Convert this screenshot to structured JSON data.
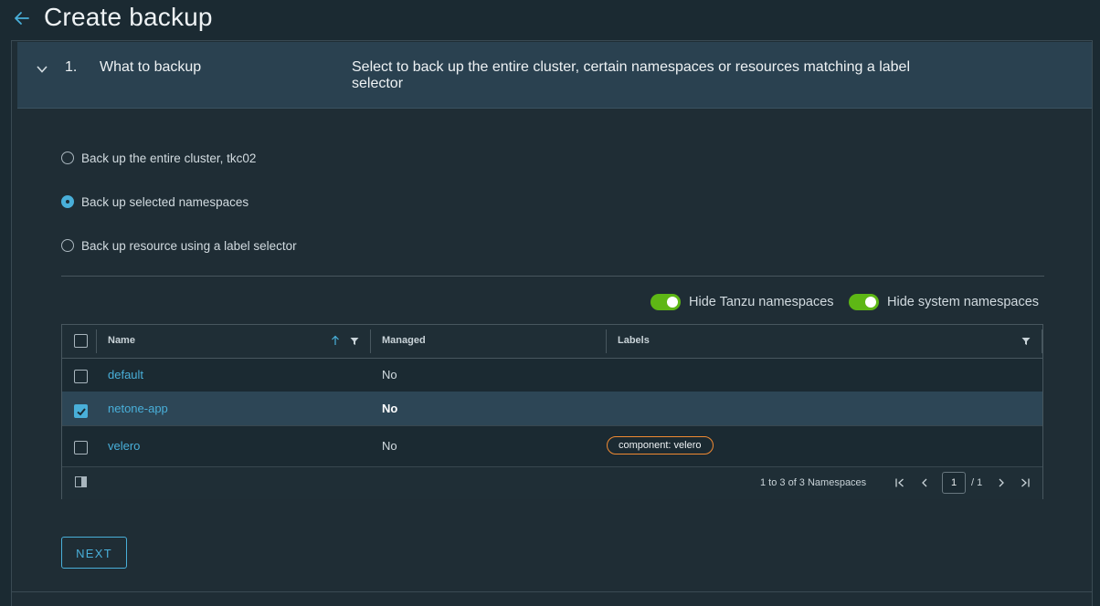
{
  "header": {
    "title": "Create backup",
    "back_icon": "arrow-left-icon"
  },
  "step": {
    "number": "1.",
    "title": "What to backup",
    "description": "Select to back up the entire cluster, certain namespaces or resources matching a label selector"
  },
  "scope_options": [
    {
      "label": "Back up the entire cluster, tkc02",
      "selected": false
    },
    {
      "label": "Back up selected namespaces",
      "selected": true
    },
    {
      "label": "Back up resource using a label selector",
      "selected": false
    }
  ],
  "toggles": [
    {
      "label": "Hide Tanzu namespaces",
      "on": true
    },
    {
      "label": "Hide system namespaces",
      "on": true
    }
  ],
  "table": {
    "columns": [
      "Name",
      "Managed",
      "Labels"
    ],
    "rows": [
      {
        "name": "default",
        "managed": "No",
        "labels": [],
        "selected": false
      },
      {
        "name": "netone-app",
        "managed": "No",
        "labels": [],
        "selected": true
      },
      {
        "name": "velero",
        "managed": "No",
        "labels": [
          "component: velero"
        ],
        "selected": false
      }
    ],
    "footer": {
      "count": "1 to 3 of 3 Namespaces",
      "page": "1",
      "total": "/ 1"
    }
  },
  "next_button": "NEXT",
  "colors": {
    "accent": "#49afd9",
    "toggle_on": "#5eb715",
    "badge_border": "#f08a32"
  }
}
